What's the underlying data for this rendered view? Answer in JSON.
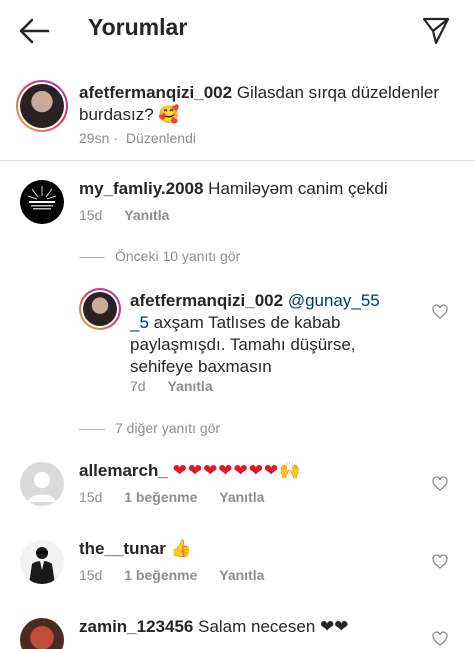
{
  "header": {
    "title": "Yorumlar"
  },
  "caption": {
    "username": "afetfermanqizi_002",
    "text": "Gilasdan sırqa düzeldenler burdasız? 🥰",
    "time": "29sn",
    "edited": "Düzenlendi"
  },
  "comments": [
    {
      "username": "my_famliy.2008",
      "text": "Hamiləyəm canim çekdi",
      "time": "15d",
      "reply_label": "Yanıtla",
      "view_replies": "Önceki 10 yanıtı gör",
      "reply": {
        "username": "afetfermanqizi_002",
        "mention": "@gunay_55_5",
        "text": "axşam Tatlıses de kabab paylaşmışdı. Tamahı düşürse, sehifeye baxmasın",
        "time": "7d",
        "reply_label": "Yanıtla"
      },
      "more_replies": "7 diğer yanıtı gör"
    },
    {
      "username": "allemarch_",
      "text": "❤❤❤❤❤❤❤🙌",
      "time": "15d",
      "likes": "1 beğenme",
      "reply_label": "Yanıtla"
    },
    {
      "username": "the__tunar",
      "text": "👍",
      "time": "15d",
      "likes": "1 beğenme",
      "reply_label": "Yanıtla"
    },
    {
      "username": "zamin_123456",
      "text": "Salam necesen ❤❤"
    }
  ],
  "colors": {
    "link": "#00376b",
    "secondary": "#8e8e8e",
    "heart": "#e0162b"
  },
  "icons": [
    "back-arrow-icon",
    "send-icon",
    "heart-outline-icon",
    "default-avatar-icon"
  ]
}
